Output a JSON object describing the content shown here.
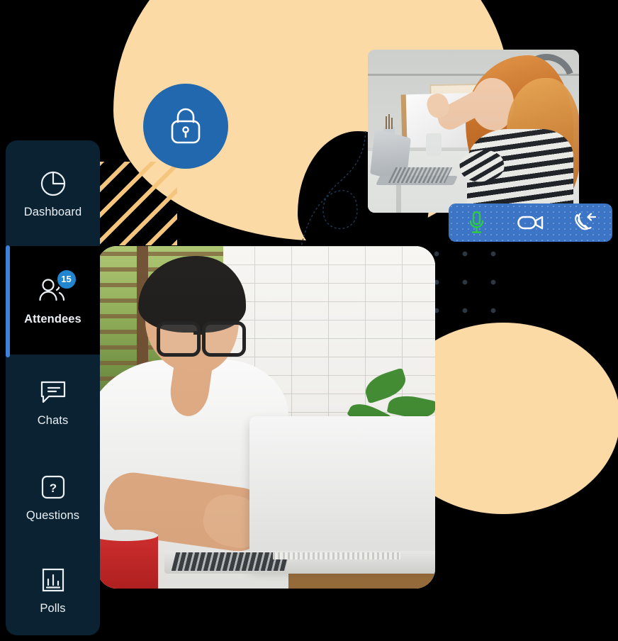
{
  "theme": {
    "sidebar_bg": "#0B2232",
    "sidebar_active_bg": "#000000",
    "accent_blue": "#3D82D9",
    "badge_blue": "#2185D0",
    "lock_circle_blue": "#2268AE",
    "callbar_blue": "#3C74C6",
    "peach": "#FCDAA6",
    "stripe_orange": "#F5C57E",
    "dot_dark": "#2B3742",
    "mic_active_green": "#2ECC40",
    "text_light": "#EAF0F4"
  },
  "sidebar": {
    "name": "webinar-navigation",
    "items": [
      {
        "id": "dashboard",
        "label": "Dashboard",
        "icon": "pie-chart-icon",
        "active": false,
        "badge": null
      },
      {
        "id": "attendees",
        "label": "Attendees",
        "icon": "users-icon",
        "active": true,
        "badge": "15"
      },
      {
        "id": "chats",
        "label": "Chats",
        "icon": "chat-bubble-icon",
        "active": false,
        "badge": null
      },
      {
        "id": "questions",
        "label": "Questions",
        "icon": "question-box-icon",
        "active": false,
        "badge": null
      },
      {
        "id": "polls",
        "label": "Polls",
        "icon": "bar-chart-box-icon",
        "active": false,
        "badge": null
      }
    ]
  },
  "call_bar": {
    "name": "call-controls",
    "buttons": [
      {
        "id": "microphone",
        "icon": "microphone-icon",
        "state": "active",
        "color": "#2ECC40"
      },
      {
        "id": "camera",
        "icon": "video-camera-icon",
        "state": "active",
        "color": "#FFFFFF"
      },
      {
        "id": "hangup",
        "icon": "phone-forward-icon",
        "state": "default",
        "color": "#FFFFFF"
      }
    ]
  },
  "security_badge": {
    "name": "security-lock-badge",
    "icon": "padlock-icon",
    "color": "#2268AE"
  },
  "media": {
    "woman_tile": {
      "name": "participant-video-woman",
      "alt": "Woman with red hair waving at laptop on a white desk"
    },
    "man_tile": {
      "name": "participant-video-man",
      "alt": "Man with glasses typing on a white laptop with a red mug"
    }
  },
  "decorations": {
    "peach_blob_top": "peach-blob-shape",
    "peach_blob_bottom": "peach-circle-shape",
    "diagonal_stripes": "diagonal-stripe-pattern",
    "dot_grid": "dot-grid-pattern",
    "dark_blob": "dark-blob-shape"
  }
}
